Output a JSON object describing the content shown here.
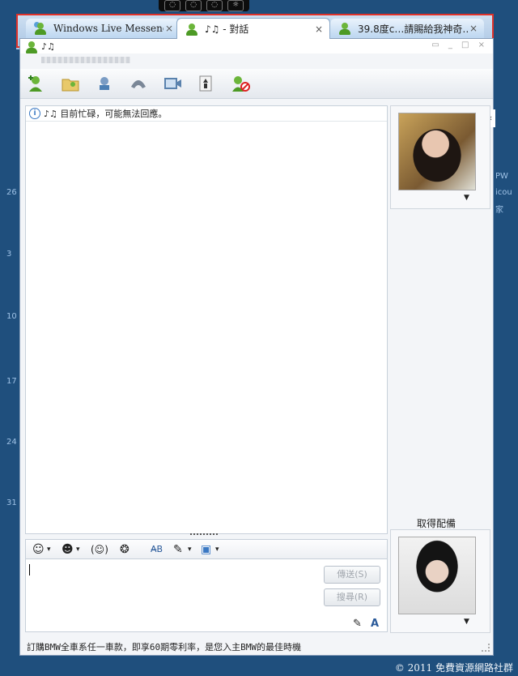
{
  "taskbar_glyphs": [
    "◌",
    "◌",
    "◌",
    "☼"
  ],
  "tabs": [
    {
      "label": "Windows Live Messenger",
      "close": "×",
      "icon": "buddy-icon"
    },
    {
      "label": "♪♫ - 對話",
      "close": "×",
      "icon": "buddy-icon"
    },
    {
      "label": "39.8度c…請賜給我神奇…",
      "close": "×",
      "icon": "buddy-icon"
    }
  ],
  "window": {
    "contact_name": "♪♫",
    "controls": "▭ _ □ ×"
  },
  "toolbar": {
    "icons": [
      "add-contact-icon",
      "share-folder-icon",
      "webcam-call-icon",
      "phone-call-icon",
      "video-icon",
      "games-icon",
      "block-contact-icon"
    ]
  },
  "conversation": {
    "status_message": "♪♫ 目前忙碌，可能無法回應。",
    "info_glyph": "i"
  },
  "format_bar": {
    "icons": [
      "emoticon-icon",
      "wink-icon",
      "nudge-icon",
      "voice-clip-icon",
      "font-icon",
      "background-icon",
      "activities-icon"
    ],
    "glyphs": [
      "☺",
      "☻",
      "(☺)",
      "❂",
      "A̶B",
      "✎",
      "▣"
    ],
    "dropdown_arrow": "▾"
  },
  "input": {
    "send_label": "傳送(S)",
    "search_label": "搜尋(R)"
  },
  "ink_bar": {
    "pen_glyph": "✎",
    "font_glyph": "A"
  },
  "side_panel": {
    "collapse_glyph": "‹",
    "get_avatar_label": "取得配備",
    "dropdown_glyph": "▼"
  },
  "ad_text": "訂購BMW全車系任一車款，即享60期零利率，是您入主BMW的最佳時機",
  "watermark": "© 2011 免費資源網路社群"
}
